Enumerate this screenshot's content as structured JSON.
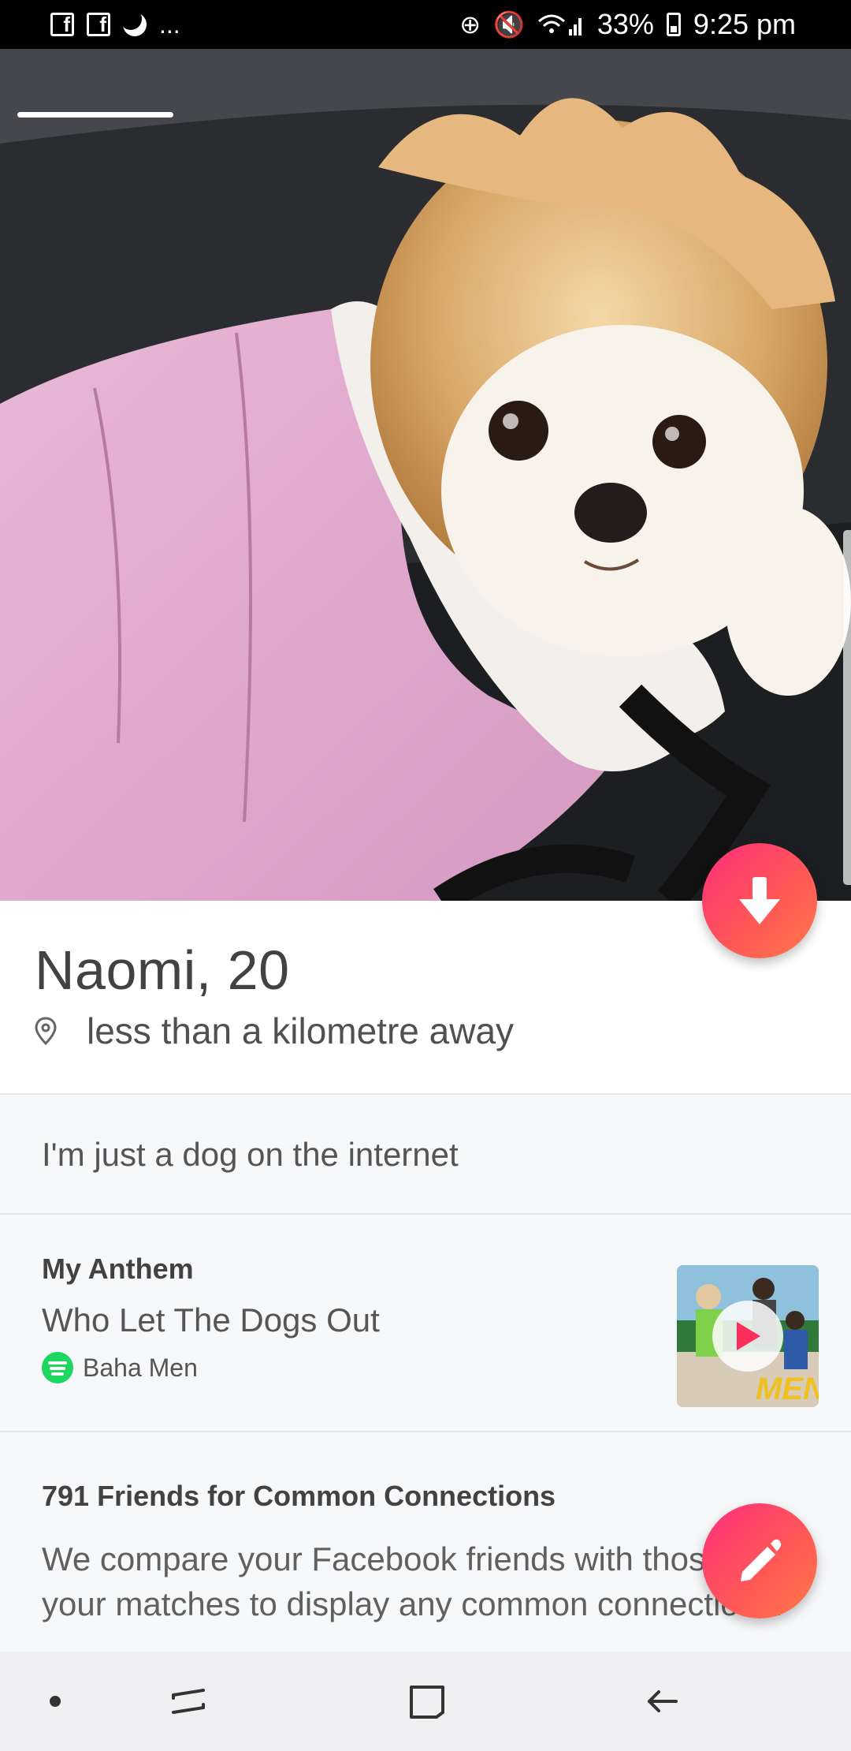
{
  "status_bar": {
    "overflow": "...",
    "battery": "33%",
    "time": "9:25 pm"
  },
  "profile": {
    "name_age": "Naomi, 20",
    "distance": "less than a kilometre away",
    "bio": "I'm just a dog on the internet",
    "photo_subject": "pomeranian-in-pink-jacket"
  },
  "anthem": {
    "heading": "My Anthem",
    "song": "Who Let The Dogs Out",
    "artist": "Baha Men",
    "album_text": "MEN"
  },
  "friends": {
    "heading": "791 Friends for Common Connections",
    "description": "We compare your Facebook friends with those of your matches to display any common connections."
  },
  "colors": {
    "accent_gradient_start": "#fd2e7b",
    "accent_gradient_end": "#ff7a48",
    "spotify_green": "#1ed760"
  },
  "icons": {
    "fab_down": "arrow-down-icon",
    "fab_edit": "pencil-icon",
    "location": "location-pin-icon",
    "spotify": "spotify-icon",
    "play": "play-icon"
  }
}
